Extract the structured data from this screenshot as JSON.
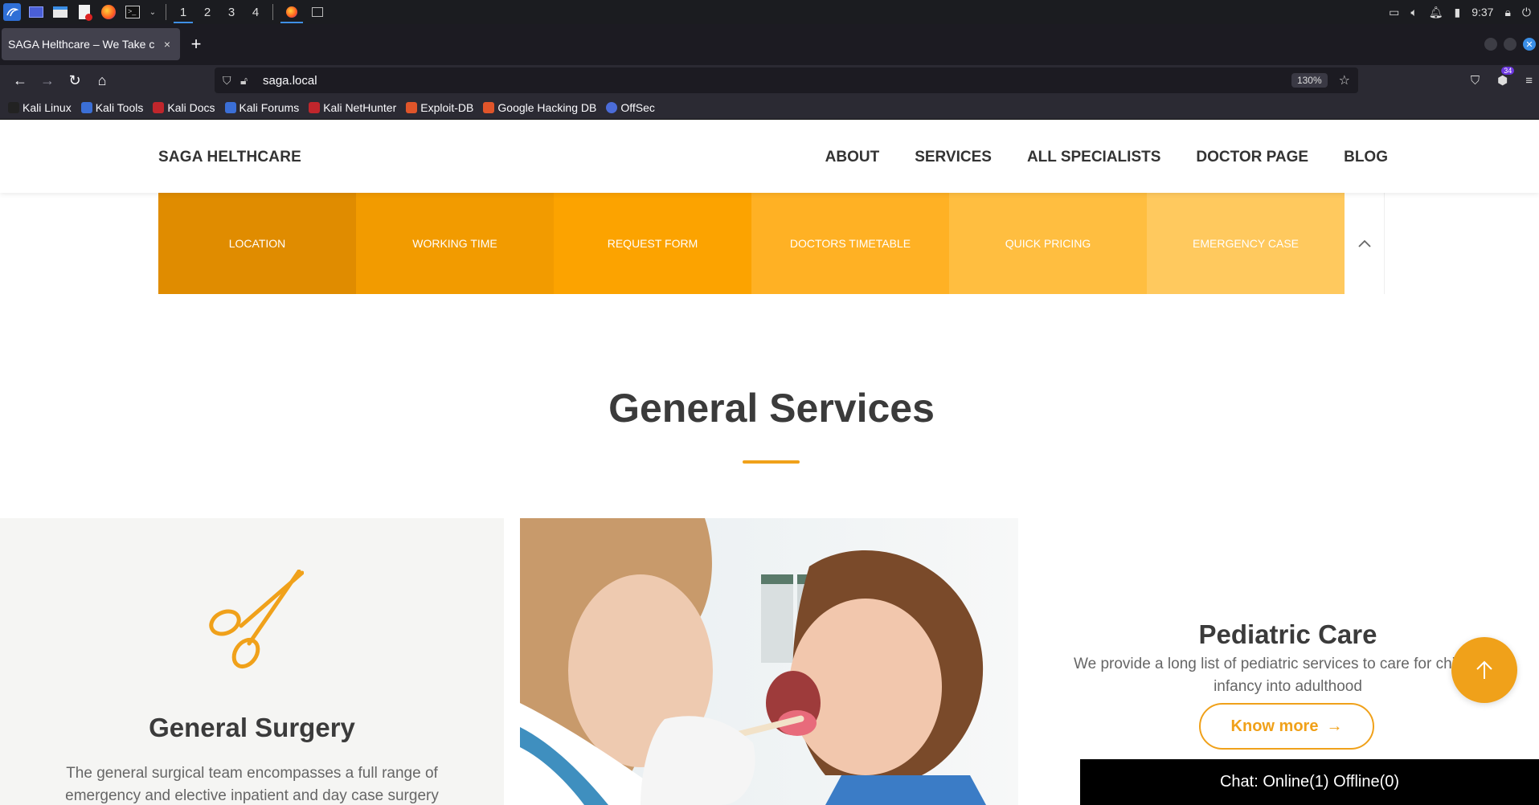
{
  "os": {
    "workspaces": [
      "1",
      "2",
      "3",
      "4"
    ],
    "clock": "9:37"
  },
  "browser": {
    "tab_title": "SAGA Helthcare – We Take c",
    "tab_close": "×",
    "new_tab": "+",
    "url": "saga.local",
    "zoom": "130%",
    "extension_badge": "34"
  },
  "bookmarks": [
    {
      "label": "Kali Linux",
      "color": "#222222"
    },
    {
      "label": "Kali Tools",
      "color": "#3b6fd6"
    },
    {
      "label": "Kali Docs",
      "color": "#c0262c"
    },
    {
      "label": "Kali Forums",
      "color": "#3b6fd6"
    },
    {
      "label": "Kali NetHunter",
      "color": "#c0262c"
    },
    {
      "label": "Exploit-DB",
      "color": "#e0552a"
    },
    {
      "label": "Google Hacking DB",
      "color": "#e0552a"
    },
    {
      "label": "OffSec",
      "color": "#4b6cd8"
    }
  ],
  "site": {
    "brand": "SAGA HELTHCARE",
    "menu": [
      "ABOUT",
      "SERVICES",
      "ALL SPECIALISTS",
      "DOCTOR PAGE",
      "BLOG"
    ],
    "quick_bar": [
      {
        "label": "LOCATION",
        "color": "#e08c00"
      },
      {
        "label": "WORKING TIME",
        "color": "#f29b00"
      },
      {
        "label": "REQUEST FORM",
        "color": "#fca300"
      },
      {
        "label": "DOCTORS TIMETABLE",
        "color": "#ffb124"
      },
      {
        "label": "QUICK PRICING",
        "color": "#ffbe40"
      },
      {
        "label": "EMERGENCY CASE",
        "color": "#ffc95e"
      }
    ],
    "section_title": "General Services",
    "left_card": {
      "title": "General Surgery",
      "text": "The general surgical team encompasses a full range of emergency and elective inpatient and day case surgery"
    },
    "right_card": {
      "title": "Pediatric Care",
      "text": "We provide a long list of pediatric services to care for child from infancy into adulthood",
      "button": "Know more"
    },
    "chat": "Chat: Online(1) Offline(0)",
    "accent": "#f0a11a"
  }
}
